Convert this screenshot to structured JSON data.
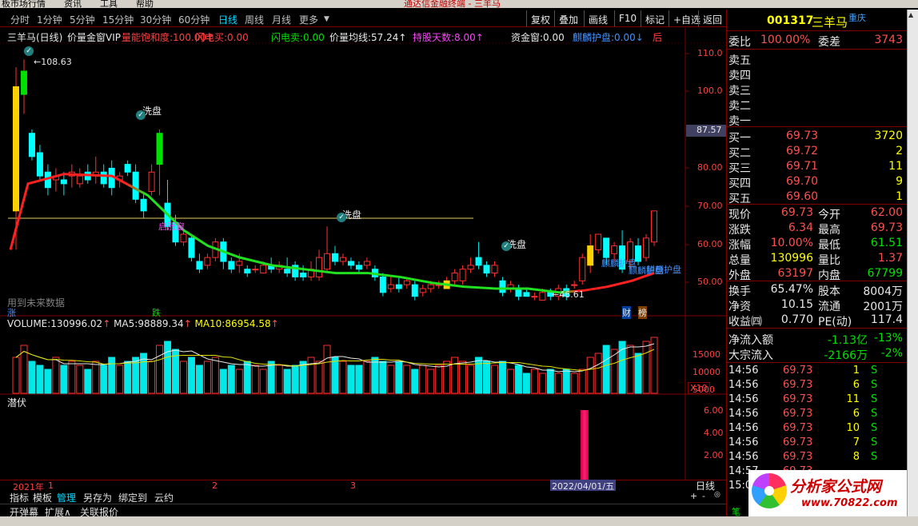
{
  "app": {
    "menu": [
      "板市场行情",
      "资讯",
      "工具",
      "帮助"
    ],
    "window_title": "通达信金融终端 - 三羊马"
  },
  "toolbar": {
    "periods": [
      "分时",
      "1分钟",
      "5分钟",
      "15分钟",
      "30分钟",
      "60分钟",
      "日线",
      "周线",
      "月线",
      "更多"
    ],
    "selected_period": "日线",
    "buttons": [
      "复权",
      "叠加",
      "画线",
      "F10",
      "标记",
      "+自选",
      "返回"
    ]
  },
  "indicator_header": {
    "stock": "三羊马(日线)",
    "formula": "价量金窗VIP",
    "items": [
      {
        "label": "量能饱和度:",
        "value": "100.00",
        "arrow": "↑",
        "color": "#ff4040"
      },
      {
        "label": "闪电买:",
        "value": "0.00",
        "arrow": "",
        "color": "#ff4040"
      },
      {
        "label": "闪电卖:",
        "value": "0.00",
        "arrow": "",
        "color": "#00e000"
      },
      {
        "label": "价量均线:",
        "value": "57.24",
        "arrow": "↑",
        "color": "#e8e8e8"
      },
      {
        "label": "持股天数:",
        "value": "8.00",
        "arrow": "↑",
        "color": "#ff40ff"
      },
      {
        "label": "资金窗:",
        "value": "0.00",
        "arrow": "",
        "color": "#e8e8e8"
      },
      {
        "label": "麒麟护盘:",
        "value": "0.00",
        "arrow": "↓",
        "color": "#4090ff"
      }
    ],
    "tail": "后"
  },
  "price_axis": {
    "labels": [
      "110.0",
      "100.0",
      "90.00",
      "80.00",
      "70.00",
      "60.00",
      "50.00"
    ],
    "current_price_tag": "87.57"
  },
  "annotations": {
    "high": "108.63",
    "low": "46.61",
    "wash": "洗盘",
    "start": "启涨窗",
    "qilin": "麒麟护盘",
    "future": "用到未来数据",
    "cai": "财",
    "bang": "榜",
    "die": "跌",
    "zhang": "涨"
  },
  "volume_header": {
    "label": "VOLUME:",
    "volume": "130996.02",
    "ma5_label": "MA5:",
    "ma5": "98889.34",
    "ma10_label": "MA10:",
    "ma10": "86954.58"
  },
  "volume_axis": {
    "labels": [
      "15000",
      "10000",
      "5000"
    ],
    "unit": "X10"
  },
  "sub_indicator": {
    "title": "潜伏",
    "axis": [
      "6.00",
      "4.00",
      "2.00"
    ]
  },
  "date_axis": {
    "labels": [
      "2021年",
      "1",
      "2",
      "3"
    ],
    "cursor_date": "2022/04/01/五",
    "period": "日线"
  },
  "bottom_tabs": [
    "指标",
    "模板",
    "管理",
    "另存为",
    "绑定到",
    "云约"
  ],
  "bottom_tabs2": [
    "开弹幕",
    "扩展∧",
    "关联报价"
  ],
  "quote": {
    "code": "001317",
    "name": "三羊马",
    "region": "重庆",
    "wei_bi_label": "委比",
    "wei_bi": "100.00%",
    "wei_cha_label": "委差",
    "wei_cha": "3743",
    "asks": [
      {
        "label": "卖五"
      },
      {
        "label": "卖四"
      },
      {
        "label": "卖三"
      },
      {
        "label": "卖二"
      },
      {
        "label": "卖一"
      }
    ],
    "bids": [
      {
        "label": "买一",
        "price": "69.73",
        "vol": "3720"
      },
      {
        "label": "买二",
        "price": "69.72",
        "vol": "2"
      },
      {
        "label": "买三",
        "price": "69.71",
        "vol": "11"
      },
      {
        "label": "买四",
        "price": "69.70",
        "vol": "9"
      },
      {
        "label": "买五",
        "price": "69.60",
        "vol": "1"
      }
    ],
    "stats": [
      {
        "l1": "现价",
        "v1": "69.73",
        "c1": "#ff5050",
        "l2": "今开",
        "v2": "62.00",
        "c2": "#ff5050"
      },
      {
        "l1": "涨跌",
        "v1": "6.34",
        "c1": "#ff5050",
        "l2": "最高",
        "v2": "69.73",
        "c2": "#ff5050"
      },
      {
        "l1": "涨幅",
        "v1": "10.00%",
        "c1": "#ff5050",
        "l2": "最低",
        "v2": "61.51",
        "c2": "#00e000"
      },
      {
        "l1": "总量",
        "v1": "130996",
        "c1": "#ffff00",
        "l2": "量比",
        "v2": "1.37",
        "c2": "#ff5050"
      },
      {
        "l1": "外盘",
        "v1": "63197",
        "c1": "#ff5050",
        "l2": "内盘",
        "v2": "67799",
        "c2": "#00e000"
      }
    ],
    "stats2": [
      {
        "l1": "换手",
        "v1": "65.47%",
        "l2": "股本",
        "v2": "8004万"
      },
      {
        "l1": "净资",
        "v1": "10.15",
        "l2": "流通",
        "v2": "2001万"
      },
      {
        "l1": "收益㈣",
        "v1": "0.770",
        "l2": "PE(动)",
        "v2": "117.4"
      }
    ],
    "flows": [
      {
        "label": "净流入额",
        "v1": "-1.13亿",
        "v2": "-13%"
      },
      {
        "label": "大宗流入",
        "v1": "-2166万",
        "v2": "-2%"
      }
    ],
    "ticks": [
      {
        "t": "14:56",
        "p": "69.73",
        "v": "1",
        "d": "S"
      },
      {
        "t": "14:56",
        "p": "69.73",
        "v": "6",
        "d": "S"
      },
      {
        "t": "14:56",
        "p": "69.73",
        "v": "11",
        "d": "S"
      },
      {
        "t": "14:56",
        "p": "69.73",
        "v": "6",
        "d": "S"
      },
      {
        "t": "14:56",
        "p": "69.73",
        "v": "10",
        "d": "S"
      },
      {
        "t": "14:56",
        "p": "69.73",
        "v": "7",
        "d": "S"
      },
      {
        "t": "14:56",
        "p": "69.73",
        "v": "8",
        "d": "S"
      },
      {
        "t": "14:57",
        "p": "69.73",
        "v": "",
        "d": ""
      },
      {
        "t": "15:0",
        "p": "",
        "v": "",
        "d": ""
      }
    ]
  },
  "logo": {
    "cn": "分析家公式网",
    "url": "www.70822.com"
  },
  "watermark": "分析家公式网 www.70822.Com",
  "bottom_right_tab": "笔",
  "chart_data": {
    "type": "candlestick",
    "ylim": [
      43,
      113
    ],
    "candles": [
      [
        70,
        102,
        60,
        107
      ],
      [
        100,
        106,
        95,
        109
      ],
      [
        90,
        84,
        83,
        91
      ],
      [
        85,
        79,
        78,
        87
      ],
      [
        80,
        76,
        74,
        82
      ],
      [
        78,
        79,
        75,
        81
      ],
      [
        78,
        77,
        74,
        80
      ],
      [
        79,
        80,
        76,
        82
      ],
      [
        77,
        79,
        76,
        81
      ],
      [
        80,
        78,
        77,
        82
      ],
      [
        79,
        80,
        77,
        84
      ],
      [
        80,
        77,
        76,
        82
      ],
      [
        81,
        76,
        74,
        83
      ],
      [
        78,
        79,
        76,
        80
      ],
      [
        82,
        80,
        79,
        83
      ],
      [
        80,
        73,
        72,
        82
      ],
      [
        73,
        70,
        68,
        75
      ],
      [
        75,
        80,
        74,
        82
      ],
      [
        82,
        90,
        74,
        91
      ],
      [
        72,
        66,
        65,
        78
      ],
      [
        67,
        62,
        61,
        69
      ],
      [
        62,
        64,
        61,
        65
      ],
      [
        63,
        58,
        57,
        64
      ],
      [
        57,
        55,
        54,
        59
      ],
      [
        56,
        58,
        55,
        59
      ],
      [
        58,
        62,
        57,
        63
      ],
      [
        62,
        57,
        55,
        63
      ],
      [
        57,
        55,
        54,
        58
      ],
      [
        56,
        57,
        54,
        59
      ],
      [
        55,
        54,
        53,
        56
      ],
      [
        55,
        55,
        54,
        56
      ],
      [
        54,
        56,
        54,
        57
      ],
      [
        56,
        55,
        54,
        58
      ],
      [
        55,
        56,
        54,
        57
      ],
      [
        55,
        54,
        53,
        58
      ],
      [
        56,
        53,
        52,
        57
      ],
      [
        54,
        53,
        52,
        56
      ],
      [
        53,
        55,
        52,
        57
      ],
      [
        53,
        58,
        52,
        60
      ],
      [
        55,
        59,
        54,
        66
      ],
      [
        59,
        57,
        56,
        61
      ],
      [
        57,
        58,
        56,
        59
      ],
      [
        57,
        56,
        55,
        58
      ],
      [
        56,
        55,
        54,
        57
      ],
      [
        56,
        57,
        55,
        58
      ],
      [
        55,
        53,
        52,
        56
      ],
      [
        53,
        49,
        48,
        54
      ],
      [
        50,
        51,
        49,
        53
      ],
      [
        51,
        50,
        49,
        53
      ],
      [
        51,
        52,
        50,
        53
      ],
      [
        51,
        48,
        47,
        52
      ],
      [
        49,
        50,
        48,
        51
      ],
      [
        50,
        51,
        49,
        52
      ],
      [
        51,
        51,
        50,
        52
      ],
      [
        50,
        52,
        50,
        53
      ],
      [
        52,
        54,
        51,
        55
      ],
      [
        52,
        55,
        51,
        56
      ],
      [
        55,
        56,
        54,
        58
      ],
      [
        58,
        56,
        55,
        62
      ],
      [
        56,
        54,
        53,
        57
      ],
      [
        54,
        56,
        53,
        57
      ],
      [
        52,
        49,
        48,
        53
      ],
      [
        50,
        51,
        49,
        52
      ],
      [
        50,
        48,
        47,
        51
      ],
      [
        49,
        48,
        48,
        50
      ],
      [
        48,
        48,
        47,
        49
      ],
      [
        47,
        49,
        47,
        50
      ],
      [
        49,
        48,
        47,
        50
      ],
      [
        48,
        50,
        47,
        51
      ],
      [
        50,
        48,
        47,
        51
      ],
      [
        51,
        51,
        50,
        52
      ],
      [
        52,
        58,
        51,
        59
      ],
      [
        56,
        61,
        54,
        64
      ],
      [
        60,
        64,
        59,
        64
      ],
      [
        63,
        58,
        56,
        63
      ],
      [
        59,
        61,
        57,
        62
      ],
      [
        61,
        55,
        54,
        65
      ],
      [
        57,
        62,
        55,
        63
      ],
      [
        61,
        57,
        56,
        63
      ],
      [
        58,
        63,
        57,
        64
      ],
      [
        62,
        70,
        61,
        70
      ]
    ],
    "ma": [
      [
        13,
        60
      ],
      [
        35,
        77
      ],
      [
        80,
        79.5
      ],
      [
        140,
        79
      ],
      [
        185,
        74
      ],
      [
        230,
        65
      ],
      [
        260,
        61
      ],
      [
        300,
        58
      ],
      [
        340,
        56
      ],
      [
        380,
        55
      ],
      [
        420,
        54
      ],
      [
        460,
        54
      ],
      [
        500,
        53
      ],
      [
        540,
        51.5
      ],
      [
        580,
        50.5
      ],
      [
        620,
        50
      ],
      [
        660,
        50
      ],
      [
        700,
        49
      ],
      [
        730,
        49.5
      ],
      [
        760,
        50.5
      ],
      [
        790,
        52
      ],
      [
        818,
        54
      ]
    ],
    "volumes": [
      9,
      12,
      8,
      7,
      6,
      9,
      7,
      8,
      7,
      6,
      8,
      7,
      9,
      7,
      8,
      9,
      10,
      8,
      12,
      13,
      11,
      8,
      9,
      7,
      8,
      9,
      6,
      7,
      6,
      8,
      7,
      6,
      8,
      7,
      6,
      7,
      8,
      9,
      8,
      12,
      9,
      8,
      7,
      7,
      8,
      9,
      8,
      7,
      8,
      7,
      6,
      7,
      6,
      7,
      8,
      9,
      8,
      7,
      9,
      8,
      7,
      8,
      6,
      7,
      5,
      6,
      5,
      6,
      5,
      6,
      5,
      6,
      9,
      10,
      12,
      11,
      13,
      12,
      10,
      13,
      14
    ]
  }
}
